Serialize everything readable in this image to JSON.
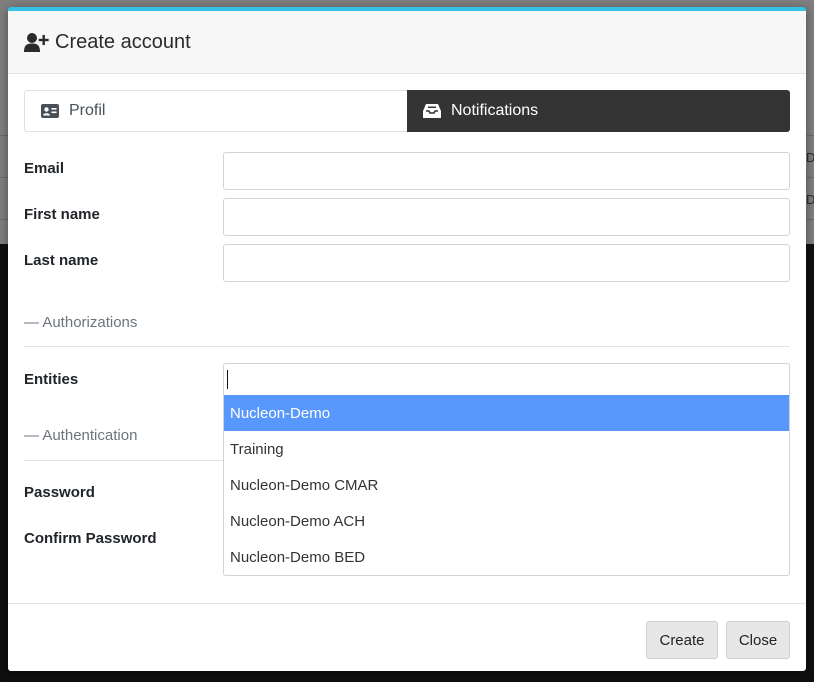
{
  "background": {
    "cells": [
      "D",
      "D"
    ]
  },
  "modal": {
    "title": "Create account",
    "icon": "user-plus-icon",
    "accent_color": "#35c2e6"
  },
  "tabs": [
    {
      "label": "Profil",
      "icon": "id-card-icon",
      "active": false
    },
    {
      "label": "Notifications",
      "icon": "inbox-icon",
      "active": true
    }
  ],
  "form": {
    "email_label": "Email",
    "email_value": "",
    "first_name_label": "First name",
    "first_name_value": "",
    "last_name_label": "Last name",
    "last_name_value": "",
    "authorizations_section": "— Authorizations",
    "entities_label": "Entities",
    "entities_search_value": "",
    "authentication_section": "— Authentication",
    "password_label": "Password",
    "confirm_password_label": "Confirm Password"
  },
  "entities_dropdown": {
    "options": [
      "Nucleon-Demo",
      "Training",
      "Nucleon-Demo CMAR",
      "Nucleon-Demo ACH",
      "Nucleon-Demo BED"
    ],
    "highlighted": "Nucleon-Demo",
    "highlight_color": "#5897fb"
  },
  "footer": {
    "create_label": "Create",
    "close_label": "Close"
  }
}
